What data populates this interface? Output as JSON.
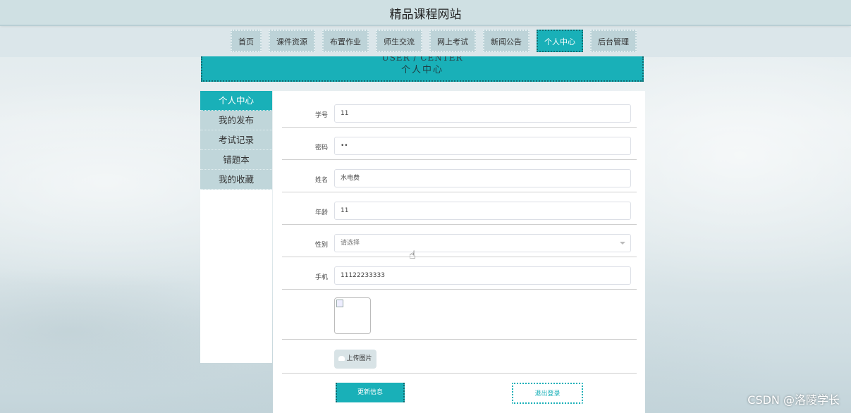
{
  "site": {
    "title": "精品课程网站"
  },
  "nav": {
    "items": [
      {
        "label": "首页"
      },
      {
        "label": "课件资源"
      },
      {
        "label": "布置作业"
      },
      {
        "label": "师生交流"
      },
      {
        "label": "网上考试"
      },
      {
        "label": "新闻公告"
      },
      {
        "label": "个人中心",
        "active": true
      },
      {
        "label": "后台管理"
      }
    ]
  },
  "banner": {
    "en": "USER / CENTER",
    "cn": "个人中心"
  },
  "sidebar": {
    "items": [
      {
        "label": "个人中心",
        "active": true
      },
      {
        "label": "我的发布"
      },
      {
        "label": "考试记录"
      },
      {
        "label": "错题本"
      },
      {
        "label": "我的收藏"
      }
    ]
  },
  "form": {
    "student_id": {
      "label": "学号",
      "value": "11"
    },
    "password": {
      "label": "密码",
      "value": "••"
    },
    "name": {
      "label": "姓名",
      "value": "水电费"
    },
    "age": {
      "label": "年龄",
      "value": "11"
    },
    "gender": {
      "label": "性别",
      "placeholder": "请选择"
    },
    "phone": {
      "label": "手机",
      "value": "11122233333"
    }
  },
  "actions": {
    "upload": "上传图片",
    "update": "更新信息",
    "logout": "退出登录"
  },
  "watermark": "CSDN @洛陵学长",
  "colors": {
    "accent": "#19b0b8",
    "nav_bg": "#bdd3d8"
  }
}
